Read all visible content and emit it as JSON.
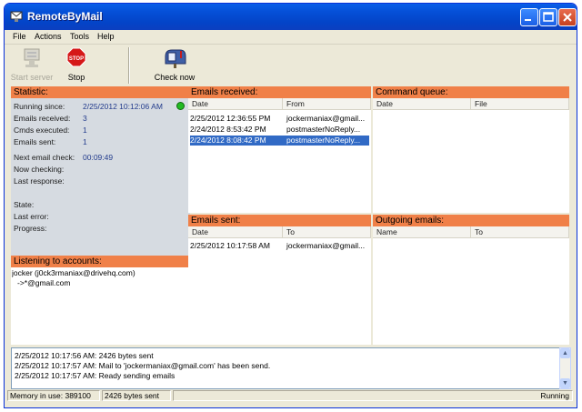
{
  "window": {
    "title": "RemoteByMail"
  },
  "menu": [
    "File",
    "Actions",
    "Tools",
    "Help"
  ],
  "toolbar": {
    "start_label": "Start server",
    "stop_label": "Stop",
    "stop_sign_text": "STOP",
    "check_label": "Check now"
  },
  "statistic": {
    "header": "Statistic:",
    "running_since_label": "Running since:",
    "running_since": "2/25/2012 10:12:06 AM",
    "emails_received_label": "Emails received:",
    "emails_received": "3",
    "cmds_executed_label": "Cmds executed:",
    "cmds_executed": "1",
    "emails_sent_label": "Emails sent:",
    "emails_sent": "1",
    "next_check_label": "Next email check:",
    "next_check": "00:09:49",
    "now_checking_label": "Now checking:",
    "last_response_label": "Last response:",
    "state_label": "State:",
    "last_error_label": "Last error:",
    "progress_label": "Progress:",
    "status_color": "#22bb22"
  },
  "accounts": {
    "header": "Listening to accounts:",
    "lines": [
      "jocker (j0ck3rmaniax@drivehq.com)",
      "->*@gmail.com"
    ]
  },
  "received": {
    "header": "Emails received:",
    "columns": [
      "Date",
      "From"
    ],
    "rows": [
      [
        "2/25/2012 12:36:55 PM",
        "jockermaniax@gmail..."
      ],
      [
        "2/24/2012 8:53:42 PM",
        "postmasterNoReply..."
      ],
      [
        "2/24/2012 8:08:42 PM",
        "postmasterNoReply..."
      ]
    ]
  },
  "queue": {
    "header": "Command queue:",
    "columns": [
      "Date",
      "File"
    ]
  },
  "sent": {
    "header": "Emails sent:",
    "columns": [
      "Date",
      "To"
    ],
    "rows": [
      [
        "2/25/2012 10:17:58 AM",
        "jockermaniax@gmail..."
      ]
    ]
  },
  "outgoing": {
    "header": "Outgoing emails:",
    "columns": [
      "Name",
      "To"
    ]
  },
  "log": [
    "2/25/2012 10:17:56 AM: 2426 bytes sent",
    "2/25/2012 10:17:57 AM: Mail to 'jockermaniax@gmail.com' has been send.",
    "2/25/2012 10:17:57 AM: Ready sending emails"
  ],
  "status": {
    "memory": "Memory in use: 389100",
    "bytes": "2426 bytes sent",
    "state": "Running"
  },
  "colors": {
    "header_orange": "#f08048",
    "selection": "#316ac5",
    "stat_bg": "#d6dbe1"
  }
}
